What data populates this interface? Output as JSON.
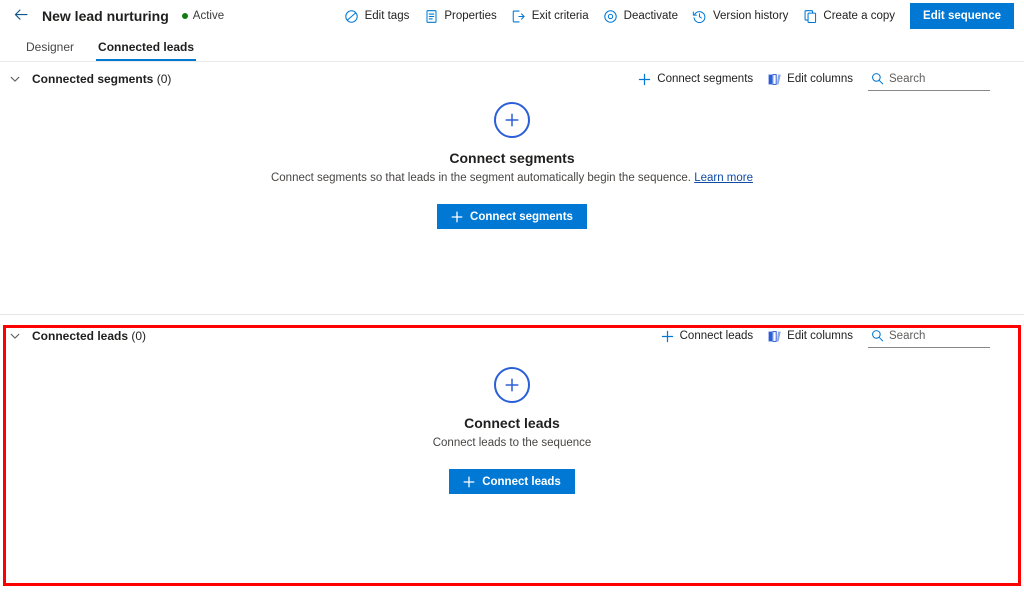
{
  "header": {
    "back_icon": "arrow-left-icon",
    "record_title": "New lead nurturing",
    "status_label": "Active",
    "status_color": "#107c10",
    "commands": [
      {
        "label": "Edit tags",
        "icon": "tag-icon"
      },
      {
        "label": "Properties",
        "icon": "document-properties-icon"
      },
      {
        "label": "Exit criteria",
        "icon": "exit-icon"
      },
      {
        "label": "Deactivate",
        "icon": "circle-stop-icon"
      },
      {
        "label": "Version history",
        "icon": "history-icon"
      },
      {
        "label": "Create a copy",
        "icon": "copy-icon"
      }
    ],
    "primary_button": "Edit sequence",
    "accent_color": "#0078d4"
  },
  "tabs": [
    {
      "label": "Designer",
      "active": false
    },
    {
      "label": "Connected leads",
      "active": true
    }
  ],
  "sections": {
    "segments": {
      "title": "Connected segments",
      "count": "(0)",
      "chevron_icon": "chevron-down-icon",
      "tools": {
        "connect_label": "Connect segments",
        "connect_icon": "plus-icon",
        "edit_columns_label": "Edit columns",
        "edit_columns_icon": "columns-icon",
        "search_icon": "search-icon",
        "search_placeholder": "Search",
        "search_value": ""
      },
      "empty": {
        "icon": "plus-circle-icon",
        "title": "Connect segments",
        "description": "Connect segments so that leads in the segment automatically begin the sequence.",
        "link_label": "Learn more",
        "button_label": "Connect segments",
        "button_icon": "plus-icon"
      }
    },
    "leads": {
      "title": "Connected leads",
      "count": "(0)",
      "chevron_icon": "chevron-down-icon",
      "tools": {
        "connect_label": "Connect leads",
        "connect_icon": "plus-icon",
        "edit_columns_label": "Edit columns",
        "edit_columns_icon": "columns-icon",
        "search_icon": "search-icon",
        "search_placeholder": "Search",
        "search_value": ""
      },
      "empty": {
        "icon": "plus-circle-icon",
        "title": "Connect leads",
        "description": "Connect leads to the sequence",
        "button_label": "Connect leads",
        "button_icon": "plus-icon"
      },
      "highlight_color": "#ff0000"
    }
  }
}
